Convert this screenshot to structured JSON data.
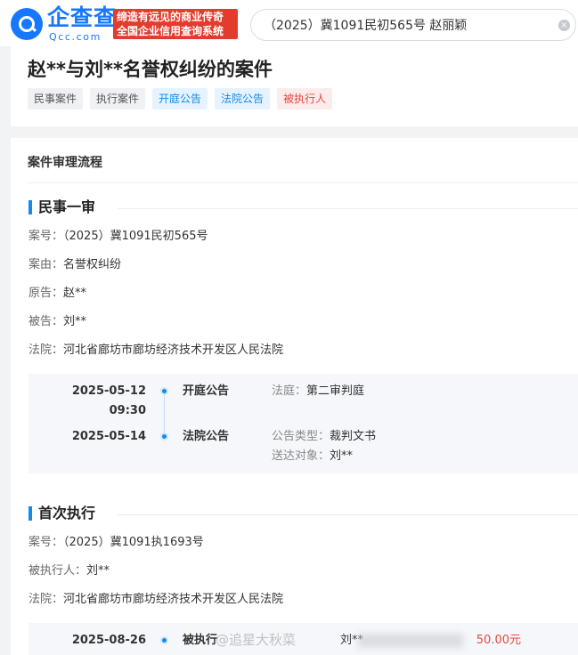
{
  "header": {
    "logo_text": "企查查",
    "logo_domain": "Qcc.com",
    "slogan_line1": "缔造有远见的商业传奇",
    "slogan_line2": "全国企业信用查询系统",
    "search_value": "（2025）冀1091民初565号 赵丽颖",
    "clear_icon": "×"
  },
  "case": {
    "title": "赵**与刘**名誉权纠纷的案件",
    "tags": [
      {
        "label": "民事案件",
        "color": "gray"
      },
      {
        "label": "执行案件",
        "color": "gray"
      },
      {
        "label": "开庭公告",
        "color": "blue"
      },
      {
        "label": "法院公告",
        "color": "blue"
      },
      {
        "label": "被执行人",
        "color": "red"
      }
    ]
  },
  "process": {
    "header": "案件审理流程",
    "stage1": {
      "title": "民事一审",
      "case_no_label": "案号：",
      "case_no": "（2025）冀1091民初565号",
      "cause_label": "案由：",
      "cause": "名誉权纠纷",
      "plaintiff_label": "原告：",
      "plaintiff": "赵**",
      "defendant_label": "被告：",
      "defendant": "刘**",
      "court_label": "法院：",
      "court": "河北省廊坊市廊坊经济技术开发区人民法院",
      "timeline": [
        {
          "date": "2025-05-12",
          "time": "09:30",
          "event": "开庭公告",
          "d1_label": "法庭：",
          "d1_value": "第二审判庭"
        },
        {
          "date": "2025-05-14",
          "time": "",
          "event": "法院公告",
          "d1_label": "公告类型：",
          "d1_value": "裁判文书",
          "d2_label": "送达对象：",
          "d2_value": "刘**"
        }
      ]
    },
    "stage2": {
      "title": "首次执行",
      "case_no_label": "案号：",
      "case_no": "（2025）冀1091执1693号",
      "executed_label": "被执行人：",
      "executed": "刘**",
      "court_label": "法院：",
      "court": "河北省廊坊市廊坊经济技术开发区人民法院",
      "timeline": [
        {
          "date": "2025-08-26",
          "event": "被执行",
          "name": "刘**",
          "amount": "50.00元"
        }
      ]
    },
    "watermark": "@追星大秋菜"
  },
  "colors": {
    "accent": "#128bed",
    "brand": "#1677ff",
    "danger": "#e5483c"
  }
}
